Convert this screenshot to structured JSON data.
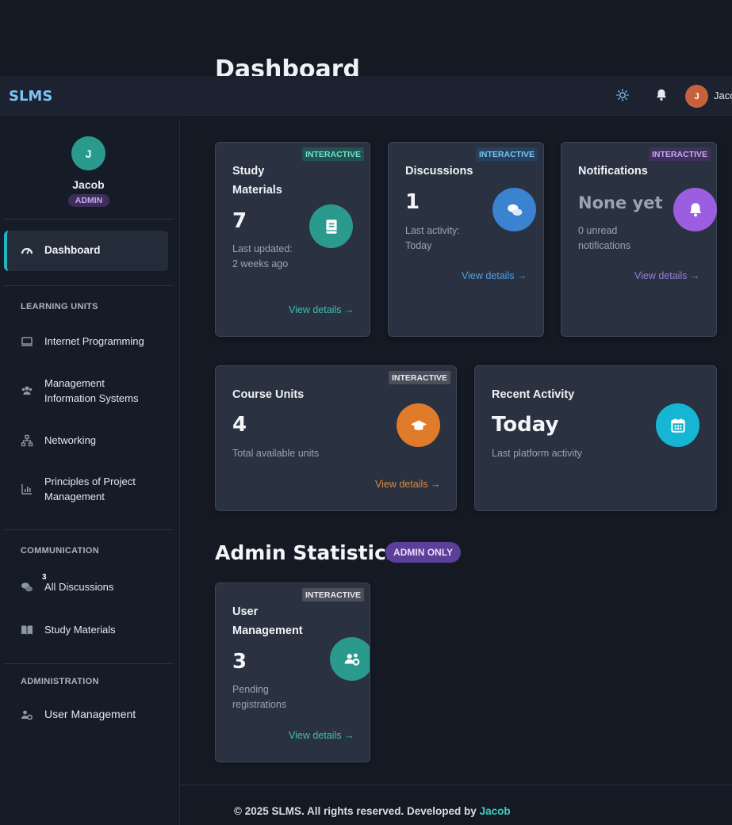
{
  "page": {
    "title": "Dashboard"
  },
  "topbar": {
    "brand": "SLMS",
    "theme_icon": "sun-icon",
    "notify_icon": "bell-icon",
    "avatar_initial": "J",
    "user_name": "Jacob"
  },
  "sidebar": {
    "avatar_initial": "J",
    "user_name": "Jacob",
    "role": "ADMIN",
    "active": {
      "label": "Dashboard",
      "icon": "gauge-icon"
    },
    "sections": [
      {
        "label": "LEARNING UNITS",
        "items": [
          {
            "label": "Internet Programming",
            "icon": "laptop-icon"
          },
          {
            "label": "Management Information Systems",
            "icon": "users-icon"
          },
          {
            "label": "Networking",
            "icon": "network-icon"
          },
          {
            "label": "Principles of Project Management",
            "icon": "chart-icon"
          }
        ]
      },
      {
        "label": "COMMUNICATION",
        "items": [
          {
            "label": "All Discussions",
            "icon": "comments-icon",
            "badge": "3"
          },
          {
            "label": "Study Materials",
            "icon": "book-open-icon"
          }
        ]
      },
      {
        "label": "ADMINISTRATION",
        "items": [
          {
            "label": "User Management",
            "icon": "users-cog-icon"
          }
        ]
      }
    ]
  },
  "cards": [
    {
      "tag": "INTERACTIVE",
      "title": "Study Materials",
      "value": "7",
      "sub": "Last updated: 2 weeks ago",
      "link": "View details →",
      "icon": "book-icon",
      "color": "#2aa596",
      "tag_color": "#3fd0c0"
    },
    {
      "tag": "INTERACTIVE",
      "title": "Discussions",
      "value": "1",
      "sub": "Last activity: Today",
      "link": "View details →",
      "icon": "comments-icon",
      "color": "#3b82d0",
      "tag_color": "#6fb3f5"
    },
    {
      "tag": "INTERACTIVE",
      "title": "Notifications",
      "value": "None yet",
      "sub": "0 unread notifications",
      "link": "View details →",
      "icon": "bell-icon",
      "color": "#9b5ee0",
      "tag_color": "#c9a6f5"
    },
    {
      "tag": "INTERACTIVE",
      "title": "Course Units",
      "value": "4",
      "sub": "Total available units",
      "link": "View details →",
      "icon": "graduation-cap-icon",
      "color": "#e07b2a",
      "tag_color": "#e6e9ef"
    },
    {
      "title": "Recent Activity",
      "value": "Today",
      "sub": "Last platform activity",
      "icon": "calendar-icon",
      "color": "#16b5d4"
    }
  ],
  "admin": {
    "title": "Admin Statistics",
    "badge": "ADMIN ONLY",
    "card": {
      "tag": "INTERACTIVE",
      "title": "User Management",
      "value": "3",
      "sub": "Pending registrations",
      "link": "View details →",
      "icon": "users-cog-icon",
      "color": "#2aa596",
      "tag_color": "#e6e9ef"
    }
  },
  "footer": {
    "text": "© 2025 SLMS. All rights reserved. Developed by",
    "dev": "Jacob"
  }
}
